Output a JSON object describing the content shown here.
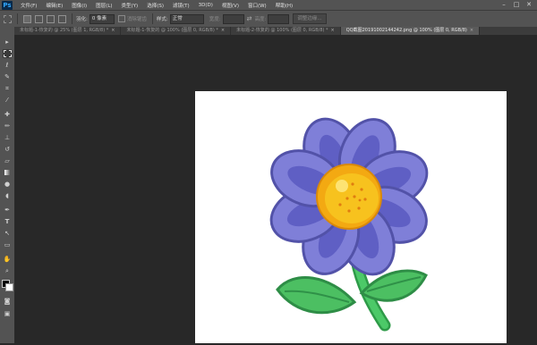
{
  "app": {
    "logo": "Ps"
  },
  "menu": [
    "文件(F)",
    "编辑(E)",
    "图像(I)",
    "图层(L)",
    "类型(Y)",
    "选择(S)",
    "滤镜(T)",
    "3D(D)",
    "视图(V)",
    "窗口(W)",
    "帮助(H)"
  ],
  "window_controls": {
    "minimize": "–",
    "maximize": "□",
    "close": "✕"
  },
  "options": {
    "feather_label": "羽化:",
    "feather_value": "0 像素",
    "antialias_label": "消除锯齿",
    "style_label": "样式:",
    "style_value": "正常",
    "width_label": "宽度:",
    "height_label": "高度:",
    "refine_edge_label": "调整边缘..."
  },
  "tabs": [
    {
      "label": "未标题-1-恢复的 @ 25% (图层 1, RGB/8) *",
      "close": "×"
    },
    {
      "label": "未标题-1-恢复的 @ 100% (图层 0, RGB/8) *",
      "close": "×"
    },
    {
      "label": "未标题-2-恢复的 @ 100% (图层 0, RGB/8) *",
      "close": "×"
    },
    {
      "label": "QQ截图20191002144242.png @ 100% (图层 0, RGB/8)",
      "close": "×"
    }
  ],
  "active_tab": 3,
  "colors": {
    "menubar": "#535353",
    "workspace": "#282828",
    "petal": "#7f7fd8",
    "petal_outline": "#5252a8",
    "center": "#f7b81a",
    "leaf": "#4cbf62",
    "stem": "#3fb357"
  },
  "tools": [
    "move-icon",
    "marquee-icon",
    "lasso-icon",
    "quick-select-icon",
    "crop-icon",
    "eyedropper-icon",
    "healing-brush-icon",
    "brush-icon",
    "clone-stamp-icon",
    "history-brush-icon",
    "eraser-icon",
    "gradient-icon",
    "blur-icon",
    "dodge-icon",
    "pen-icon",
    "type-icon",
    "path-select-icon",
    "rectangle-icon",
    "hand-icon",
    "zoom-icon",
    "color-swatches-icon",
    "quick-mask-icon",
    "screen-mode-icon"
  ]
}
